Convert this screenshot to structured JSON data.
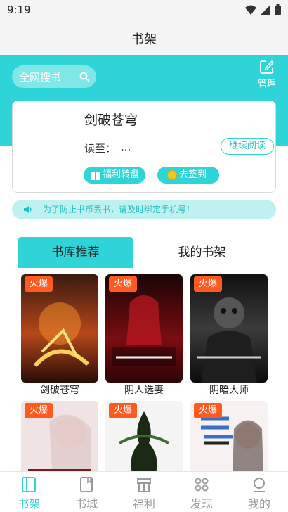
{
  "status": {
    "time": "9:19"
  },
  "page": {
    "title": "书架"
  },
  "search": {
    "label": "全网搜书"
  },
  "manage": {
    "label": "管理"
  },
  "current_book": {
    "title": "剑破苍穹",
    "read_label": "读至：",
    "read_value": "...",
    "continue_label": "继续阅读",
    "welfare_label": "福利转盘",
    "signin_label": "去签到"
  },
  "notice": {
    "text": "为了防止书币丢书，请及时绑定手机号！"
  },
  "tabs": [
    {
      "label": "书库推荐"
    },
    {
      "label": "我的书架"
    }
  ],
  "books": [
    {
      "name": "剑破苍穹",
      "badge": "火爆"
    },
    {
      "name": "阴人选妻",
      "badge": "火爆"
    },
    {
      "name": "阴暗大师",
      "badge": "火爆"
    },
    {
      "name": "",
      "badge": "火爆"
    },
    {
      "name": "",
      "badge": "火爆"
    },
    {
      "name": "",
      "badge": "火爆"
    }
  ],
  "nav": [
    {
      "label": "书架",
      "icon": "bookshelf-icon"
    },
    {
      "label": "书城",
      "icon": "bookstore-icon"
    },
    {
      "label": "福利",
      "icon": "gift-icon"
    },
    {
      "label": "发现",
      "icon": "discover-icon"
    },
    {
      "label": "我的",
      "icon": "profile-icon"
    }
  ],
  "colors": {
    "accent": "#2ed4d7",
    "badge": "#ff5a1f",
    "nav_inactive": "#999999"
  }
}
